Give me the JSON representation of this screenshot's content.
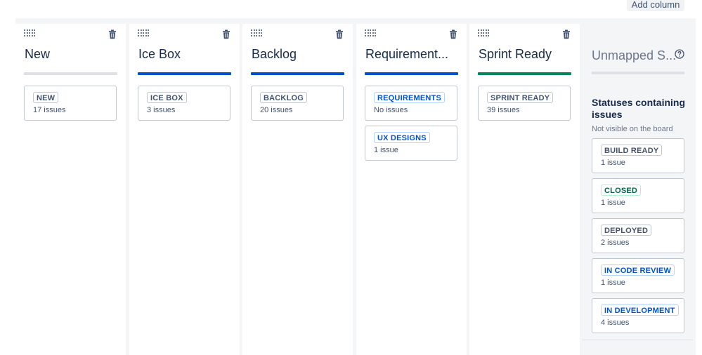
{
  "toolbar": {
    "add_column_label": "Add column"
  },
  "columns": [
    {
      "title": "New",
      "bar_color": "#dfe1e6",
      "statuses": [
        {
          "name": "NEW",
          "count": "17 issues",
          "tone": "grey"
        }
      ]
    },
    {
      "title": "Ice Box",
      "bar_color": "#0052cc",
      "statuses": [
        {
          "name": "ICE BOX",
          "count": "3 issues",
          "tone": "grey"
        }
      ]
    },
    {
      "title": "Backlog",
      "bar_color": "#0052cc",
      "statuses": [
        {
          "name": "BACKLOG",
          "count": "20 issues",
          "tone": "grey"
        }
      ]
    },
    {
      "title": "Requirement...",
      "bar_color": "#0052cc",
      "statuses": [
        {
          "name": "REQUIREMENTS",
          "count": "No issues",
          "tone": "blue"
        },
        {
          "name": "UX DESIGNS",
          "count": "1 issue",
          "tone": "blue"
        }
      ]
    },
    {
      "title": "Sprint Ready",
      "bar_color": "#00875a",
      "statuses": [
        {
          "name": "SPRINT READY",
          "count": "39 issues",
          "tone": "grey"
        }
      ]
    }
  ],
  "unmapped": {
    "title": "Unmapped S...",
    "section_title": "Statuses containing issues",
    "section_subtitle": "Not visible on the board",
    "statuses": [
      {
        "name": "BUILD READY",
        "count": "1 issue",
        "tone": "grey"
      },
      {
        "name": "CLOSED",
        "count": "1 issue",
        "tone": "green"
      },
      {
        "name": "DEPLOYED",
        "count": "2 issues",
        "tone": "grey"
      },
      {
        "name": "IN CODE REVIEW",
        "count": "1 issue",
        "tone": "blue"
      },
      {
        "name": "IN DEVELOPMENT",
        "count": "4 issues",
        "tone": "blue"
      }
    ]
  },
  "icons": {
    "drag": "drag-handle-icon",
    "delete": "trash-icon",
    "help": "question-circle-icon"
  }
}
